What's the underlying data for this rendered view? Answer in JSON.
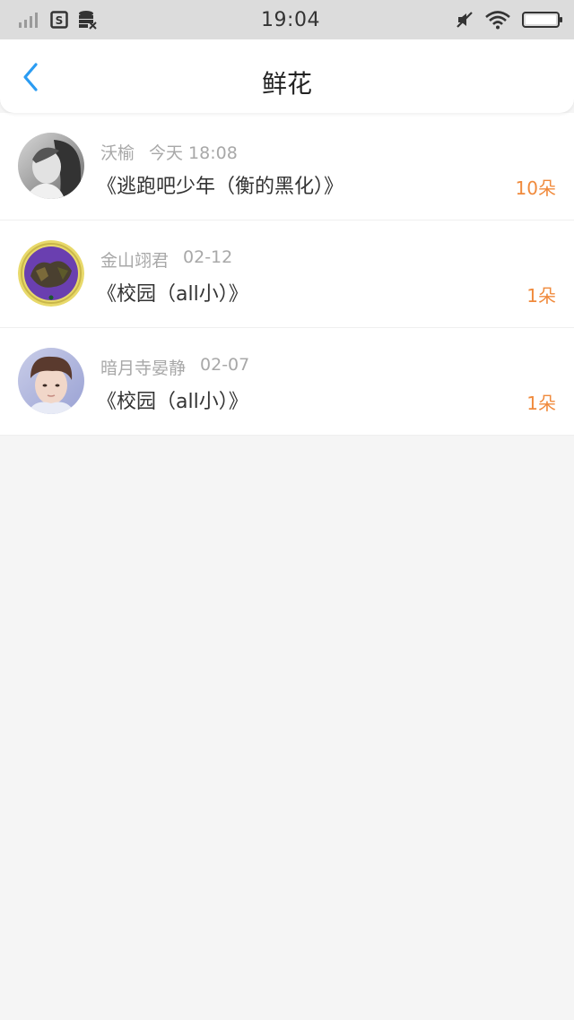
{
  "status_bar": {
    "time": "19:04",
    "icons_left": [
      "signal-bars-icon",
      "sim-s-icon",
      "database-icon"
    ],
    "icons_right": [
      "mute-icon",
      "wifi-icon",
      "battery-icon"
    ]
  },
  "nav": {
    "title": "鲜花",
    "back_icon": "chevron-left-icon",
    "accent_color": "#2b9cf2"
  },
  "rows": [
    {
      "user": "沃榆",
      "time": "今天 18:08",
      "book": "《逃跑吧少年（衡的黑化）》",
      "count": "10朵",
      "avatar": "grayscale-girl-photo"
    },
    {
      "user": "金山翊君",
      "time": "02-12",
      "book": "《校园（all小）》",
      "count": "1朵",
      "avatar": "purple-emblem-badge"
    },
    {
      "user": "暗月寺晏静",
      "time": "02-07",
      "book": "《校园（all小）》",
      "count": "1朵",
      "avatar": "boy-portrait-photo"
    }
  ],
  "colors": {
    "count": "#f08a3c",
    "meta": "#a8a8a8",
    "background": "#f5f5f5"
  }
}
